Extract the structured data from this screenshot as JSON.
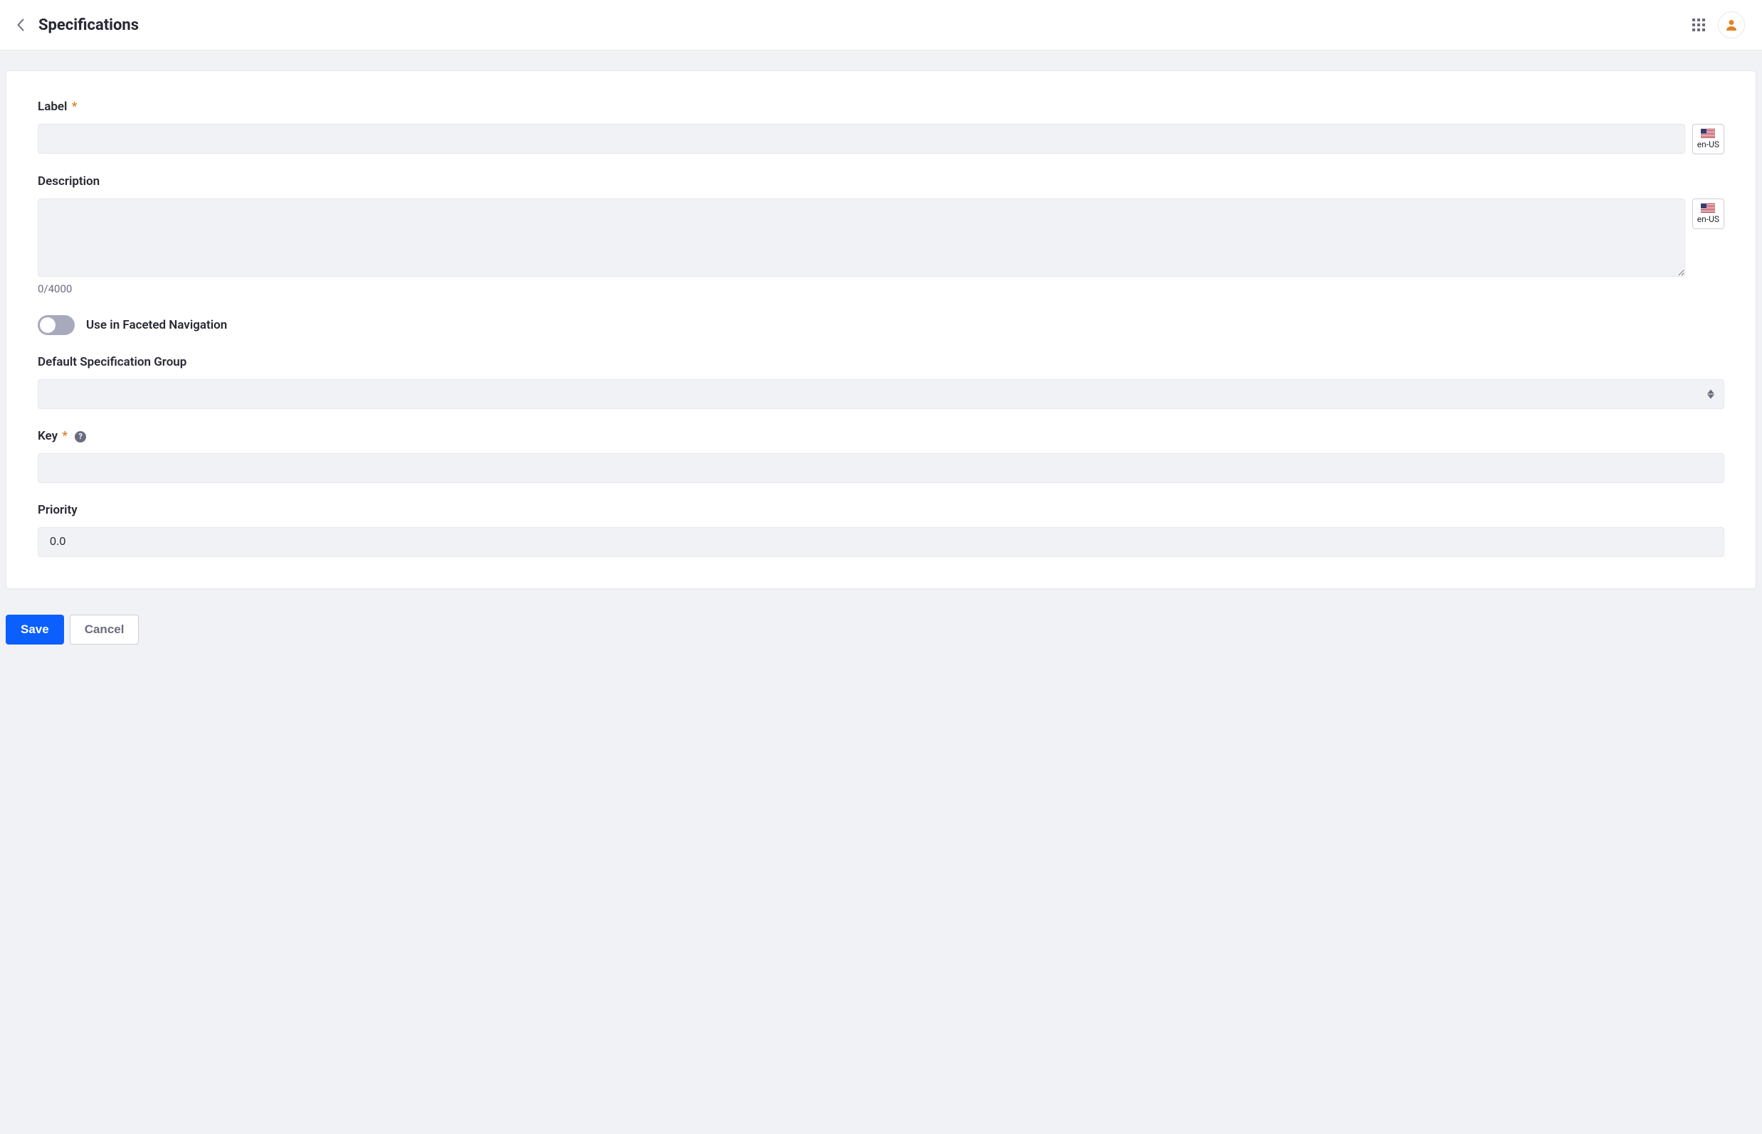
{
  "header": {
    "title": "Specifications",
    "locale": "en-US"
  },
  "form": {
    "label": {
      "text": "Label",
      "value": "",
      "required": true,
      "locale": "en-US"
    },
    "description": {
      "text": "Description",
      "value": "",
      "counter": "0/4000",
      "locale": "en-US"
    },
    "facetedNav": {
      "text": "Use in Faceted Navigation",
      "enabled": false
    },
    "defaultGroup": {
      "text": "Default Specification Group",
      "value": ""
    },
    "key": {
      "text": "Key",
      "value": "",
      "required": true,
      "help": "?"
    },
    "priority": {
      "text": "Priority",
      "value": "0.0"
    }
  },
  "buttons": {
    "save": "Save",
    "cancel": "Cancel"
  }
}
